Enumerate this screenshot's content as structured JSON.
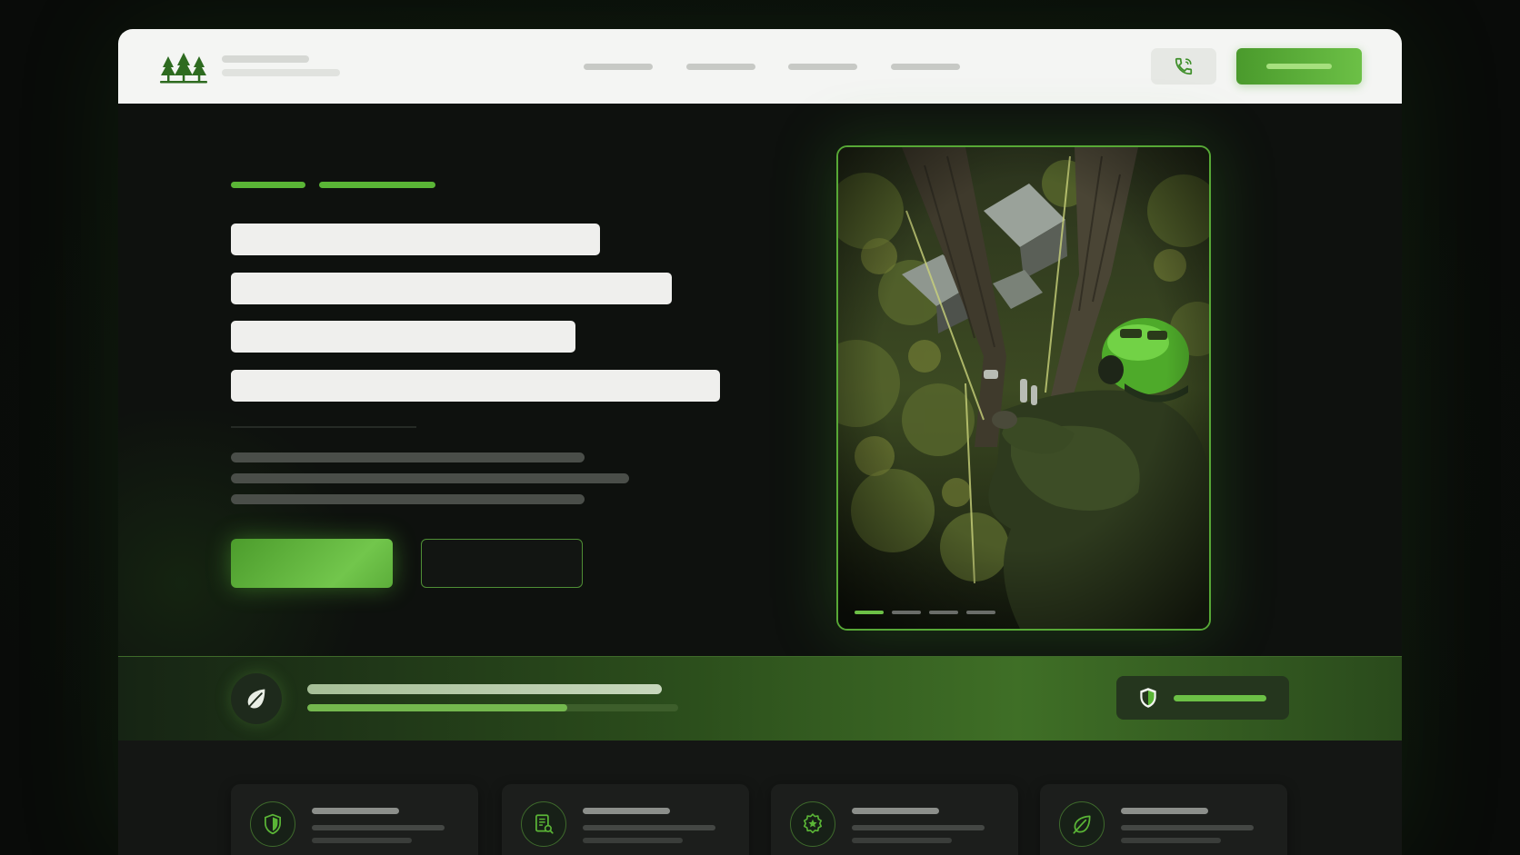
{
  "navbar": {
    "logo_icon": "pine-trees-icon",
    "phone_icon": "phone-icon"
  },
  "colors": {
    "accent": "#6cc046",
    "accent_dark": "#4a9a2c",
    "navbar_bg": "#f4f5f3",
    "page_bg": "#0e110e"
  },
  "hero": {
    "image_icon": "arborist-climbing-tree-photo",
    "carousel": {
      "slide_count": 4,
      "active_index": 0
    }
  },
  "trust_strip": {
    "badge_icon": "leaf-icon",
    "pill_icon": "shield-icon",
    "progress_fraction": 0.7
  },
  "features": {
    "cards": [
      {
        "icon": "shield-icon"
      },
      {
        "icon": "certificate-icon"
      },
      {
        "icon": "star-badge-icon"
      },
      {
        "icon": "leaf-icon"
      }
    ]
  }
}
